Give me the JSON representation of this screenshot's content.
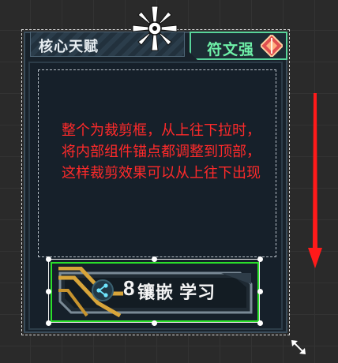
{
  "tabs": {
    "core_talent": "核心天赋",
    "rune_enhance": "符文强"
  },
  "note": "整个为裁剪框，从上往下拉时，将内部组件锚点都调整到顶部，这样裁剪效果可以从上往下出现",
  "button": {
    "number": "8",
    "label": "镶嵌 学习"
  },
  "colors": {
    "note_text": "#ff2a2a",
    "rune_accent": "#6ef0a8",
    "selection_green": "#2ae02a",
    "arrow": "#ff1a1a"
  },
  "icons": {
    "anchor": "anchor-icon",
    "rune": "rune-diamond-icon",
    "share": "share-icon",
    "resize": "resize-arrows-icon",
    "arrow": "down-arrow-icon"
  }
}
